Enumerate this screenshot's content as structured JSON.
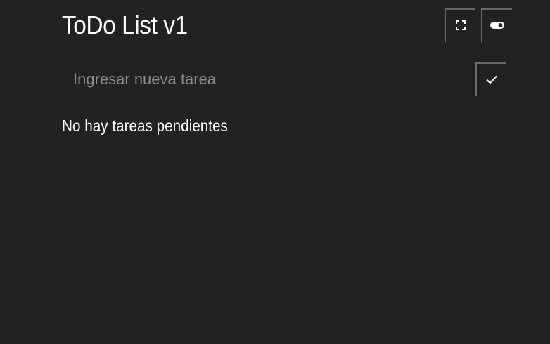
{
  "header": {
    "title": "ToDo List v1",
    "fullscreen_icon": "fullscreen-icon",
    "theme_toggle_icon": "toggle-icon"
  },
  "form": {
    "input_value": "",
    "input_placeholder": "Ingresar nueva tarea",
    "submit_icon": "check-icon"
  },
  "tasks": {
    "items": [],
    "empty_message": "No hay tareas pendientes"
  },
  "colors": {
    "background": "#222222",
    "text": "#ffffff",
    "placeholder": "#8c8c8c",
    "button_border": "#6a6a6a"
  }
}
